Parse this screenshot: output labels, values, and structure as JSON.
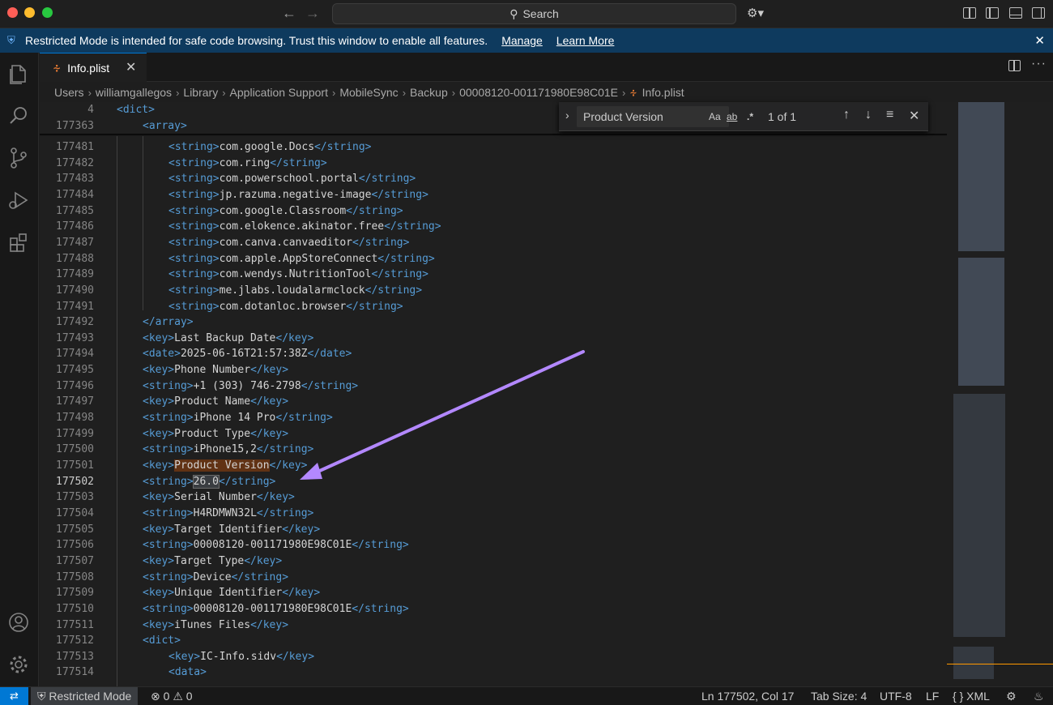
{
  "titlebar": {
    "search_label": "Search",
    "copilot_icon": "copilot-icon"
  },
  "banner": {
    "text": "Restricted Mode is intended for safe code browsing. Trust this window to enable all features.",
    "manage_label": "Manage",
    "learn_more_label": "Learn More"
  },
  "tab": {
    "label": "Info.plist",
    "icon": "rss-icon"
  },
  "breadcrumb": [
    "Users",
    "williamgallegos",
    "Library",
    "Application Support",
    "MobileSync",
    "Backup",
    "00008120-001171980E98C01E",
    "Info.plist"
  ],
  "find": {
    "query": "Product Version",
    "match_case": "Aa",
    "whole_word": "ab",
    "regex": ".*",
    "count": "1 of 1"
  },
  "sticky_lines": [
    {
      "num": "4",
      "indent": 0,
      "parts": [
        [
          "tag",
          "<dict>"
        ]
      ]
    },
    {
      "num": "177363",
      "indent": 1,
      "parts": [
        [
          "tag",
          "<array>"
        ]
      ]
    }
  ],
  "lines": [
    {
      "num": "177481",
      "indent": 2,
      "parts": [
        [
          "tag",
          "<string>"
        ],
        [
          "txt",
          "com.google.Docs"
        ],
        [
          "tag",
          "</string>"
        ]
      ]
    },
    {
      "num": "177482",
      "indent": 2,
      "parts": [
        [
          "tag",
          "<string>"
        ],
        [
          "txt",
          "com.ring"
        ],
        [
          "tag",
          "</string>"
        ]
      ]
    },
    {
      "num": "177483",
      "indent": 2,
      "parts": [
        [
          "tag",
          "<string>"
        ],
        [
          "txt",
          "com.powerschool.portal"
        ],
        [
          "tag",
          "</string>"
        ]
      ]
    },
    {
      "num": "177484",
      "indent": 2,
      "parts": [
        [
          "tag",
          "<string>"
        ],
        [
          "txt",
          "jp.razuma.negative-image"
        ],
        [
          "tag",
          "</string>"
        ]
      ]
    },
    {
      "num": "177485",
      "indent": 2,
      "parts": [
        [
          "tag",
          "<string>"
        ],
        [
          "txt",
          "com.google.Classroom"
        ],
        [
          "tag",
          "</string>"
        ]
      ]
    },
    {
      "num": "177486",
      "indent": 2,
      "parts": [
        [
          "tag",
          "<string>"
        ],
        [
          "txt",
          "com.elokence.akinator.free"
        ],
        [
          "tag",
          "</string>"
        ]
      ]
    },
    {
      "num": "177487",
      "indent": 2,
      "parts": [
        [
          "tag",
          "<string>"
        ],
        [
          "txt",
          "com.canva.canvaeditor"
        ],
        [
          "tag",
          "</string>"
        ]
      ]
    },
    {
      "num": "177488",
      "indent": 2,
      "parts": [
        [
          "tag",
          "<string>"
        ],
        [
          "txt",
          "com.apple.AppStoreConnect"
        ],
        [
          "tag",
          "</string>"
        ]
      ]
    },
    {
      "num": "177489",
      "indent": 2,
      "parts": [
        [
          "tag",
          "<string>"
        ],
        [
          "txt",
          "com.wendys.NutritionTool"
        ],
        [
          "tag",
          "</string>"
        ]
      ]
    },
    {
      "num": "177490",
      "indent": 2,
      "parts": [
        [
          "tag",
          "<string>"
        ],
        [
          "txt",
          "me.jlabs.loudalarmclock"
        ],
        [
          "tag",
          "</string>"
        ]
      ]
    },
    {
      "num": "177491",
      "indent": 2,
      "parts": [
        [
          "tag",
          "<string>"
        ],
        [
          "txt",
          "com.dotanloc.browser"
        ],
        [
          "tag",
          "</string>"
        ]
      ]
    },
    {
      "num": "177492",
      "indent": 1,
      "parts": [
        [
          "tag",
          "</array>"
        ]
      ]
    },
    {
      "num": "177493",
      "indent": 1,
      "parts": [
        [
          "tag",
          "<key>"
        ],
        [
          "txt",
          "Last Backup Date"
        ],
        [
          "tag",
          "</key>"
        ]
      ]
    },
    {
      "num": "177494",
      "indent": 1,
      "parts": [
        [
          "tag",
          "<date>"
        ],
        [
          "txt",
          "2025-06-16T21:57:38Z"
        ],
        [
          "tag",
          "</date>"
        ]
      ]
    },
    {
      "num": "177495",
      "indent": 1,
      "parts": [
        [
          "tag",
          "<key>"
        ],
        [
          "txt",
          "Phone Number"
        ],
        [
          "tag",
          "</key>"
        ]
      ]
    },
    {
      "num": "177496",
      "indent": 1,
      "parts": [
        [
          "tag",
          "<string>"
        ],
        [
          "txt",
          "+1 (303) 746-2798"
        ],
        [
          "tag",
          "</string>"
        ]
      ]
    },
    {
      "num": "177497",
      "indent": 1,
      "parts": [
        [
          "tag",
          "<key>"
        ],
        [
          "txt",
          "Product Name"
        ],
        [
          "tag",
          "</key>"
        ]
      ]
    },
    {
      "num": "177498",
      "indent": 1,
      "parts": [
        [
          "tag",
          "<string>"
        ],
        [
          "txt",
          "iPhone 14 Pro"
        ],
        [
          "tag",
          "</string>"
        ]
      ]
    },
    {
      "num": "177499",
      "indent": 1,
      "parts": [
        [
          "tag",
          "<key>"
        ],
        [
          "txt",
          "Product Type"
        ],
        [
          "tag",
          "</key>"
        ]
      ]
    },
    {
      "num": "177500",
      "indent": 1,
      "parts": [
        [
          "tag",
          "<string>"
        ],
        [
          "txt",
          "iPhone15,2"
        ],
        [
          "tag",
          "</string>"
        ]
      ]
    },
    {
      "num": "177501",
      "indent": 1,
      "parts": [
        [
          "tag",
          "<key>"
        ],
        [
          "match",
          "Product Version"
        ],
        [
          "tag",
          "</key>"
        ]
      ]
    },
    {
      "num": "177502",
      "indent": 1,
      "current": true,
      "parts": [
        [
          "tag",
          "<string>"
        ],
        [
          "sel",
          "26.0"
        ],
        [
          "tag",
          "</string>"
        ]
      ]
    },
    {
      "num": "177503",
      "indent": 1,
      "parts": [
        [
          "tag",
          "<key>"
        ],
        [
          "txt",
          "Serial Number"
        ],
        [
          "tag",
          "</key>"
        ]
      ]
    },
    {
      "num": "177504",
      "indent": 1,
      "parts": [
        [
          "tag",
          "<string>"
        ],
        [
          "txt",
          "H4RDMWN32L"
        ],
        [
          "tag",
          "</string>"
        ]
      ]
    },
    {
      "num": "177505",
      "indent": 1,
      "parts": [
        [
          "tag",
          "<key>"
        ],
        [
          "txt",
          "Target Identifier"
        ],
        [
          "tag",
          "</key>"
        ]
      ]
    },
    {
      "num": "177506",
      "indent": 1,
      "parts": [
        [
          "tag",
          "<string>"
        ],
        [
          "txt",
          "00008120-001171980E98C01E"
        ],
        [
          "tag",
          "</string>"
        ]
      ]
    },
    {
      "num": "177507",
      "indent": 1,
      "parts": [
        [
          "tag",
          "<key>"
        ],
        [
          "txt",
          "Target Type"
        ],
        [
          "tag",
          "</key>"
        ]
      ]
    },
    {
      "num": "177508",
      "indent": 1,
      "parts": [
        [
          "tag",
          "<string>"
        ],
        [
          "txt",
          "Device"
        ],
        [
          "tag",
          "</string>"
        ]
      ]
    },
    {
      "num": "177509",
      "indent": 1,
      "parts": [
        [
          "tag",
          "<key>"
        ],
        [
          "txt",
          "Unique Identifier"
        ],
        [
          "tag",
          "</key>"
        ]
      ]
    },
    {
      "num": "177510",
      "indent": 1,
      "parts": [
        [
          "tag",
          "<string>"
        ],
        [
          "txt",
          "00008120-001171980E98C01E"
        ],
        [
          "tag",
          "</string>"
        ]
      ]
    },
    {
      "num": "177511",
      "indent": 1,
      "parts": [
        [
          "tag",
          "<key>"
        ],
        [
          "txt",
          "iTunes Files"
        ],
        [
          "tag",
          "</key>"
        ]
      ]
    },
    {
      "num": "177512",
      "indent": 1,
      "parts": [
        [
          "tag",
          "<dict>"
        ]
      ]
    },
    {
      "num": "177513",
      "indent": 2,
      "parts": [
        [
          "tag",
          "<key>"
        ],
        [
          "txt",
          "IC-Info.sidv"
        ],
        [
          "tag",
          "</key>"
        ]
      ]
    },
    {
      "num": "177514",
      "indent": 2,
      "parts": [
        [
          "tag",
          "<data>"
        ]
      ]
    }
  ],
  "statusbar": {
    "restricted_label": "Restricted Mode",
    "errors": "0",
    "warnings": "0",
    "position": "Ln 177502, Col 17",
    "tab_size": "Tab Size: 4",
    "encoding": "UTF-8",
    "eol": "LF",
    "language": "XML"
  },
  "colors": {
    "tag": "#569cd6",
    "text": "#d4d4d4",
    "banner": "#0e3a5e",
    "accent": "#0078d4",
    "arrow": "#b388ff",
    "find_match": "#613214"
  }
}
